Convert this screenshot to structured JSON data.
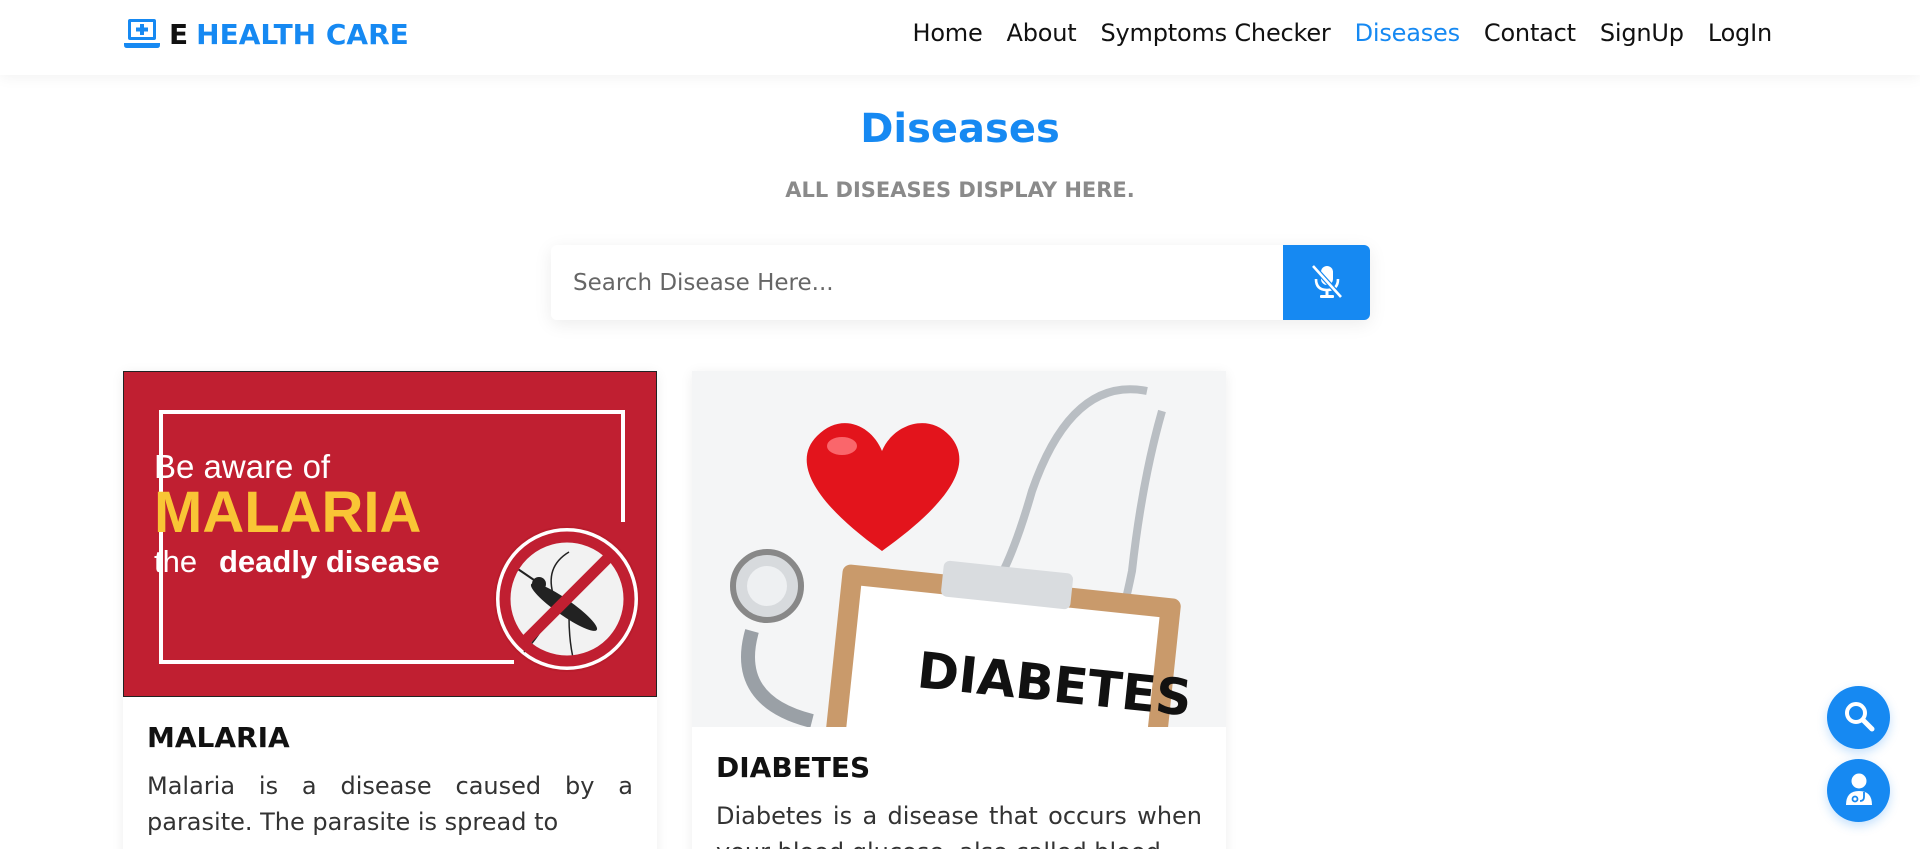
{
  "brand": {
    "prefix": "E",
    "name": "HEALTH CARE"
  },
  "nav": {
    "items": [
      {
        "label": "Home"
      },
      {
        "label": "About"
      },
      {
        "label": "Symptoms Checker"
      },
      {
        "label": "Diseases"
      },
      {
        "label": "Contact"
      },
      {
        "label": "SignUp"
      },
      {
        "label": "LogIn"
      }
    ],
    "active": "Diseases"
  },
  "section": {
    "title": "Diseases",
    "subtitle": "ALL DISEASES DISPLAY HERE."
  },
  "search": {
    "placeholder": "Search Disease Here...",
    "value": ""
  },
  "cards": [
    {
      "title": "MALARIA",
      "text": "Malaria is a disease caused by a parasite. The parasite is spread to",
      "image": {
        "line1": "Be aware of",
        "line2": "MALARIA",
        "line3_prefix": "the",
        "line3_bold": "deadly disease"
      }
    },
    {
      "title": "DIABETES",
      "text": "Diabetes is a disease that occurs when your blood glucose, also called blood",
      "image": {
        "clipboard_text": "DIABETES"
      }
    }
  ],
  "colors": {
    "accent": "#1689f2",
    "malaria_red": "#c01f31",
    "malaria_yellow": "#f9c535"
  },
  "icons": {
    "logo": "laptop-medical-icon",
    "mic": "microphone-slash-icon",
    "fab_search": "search-icon",
    "fab_doctor": "doctor-icon"
  }
}
